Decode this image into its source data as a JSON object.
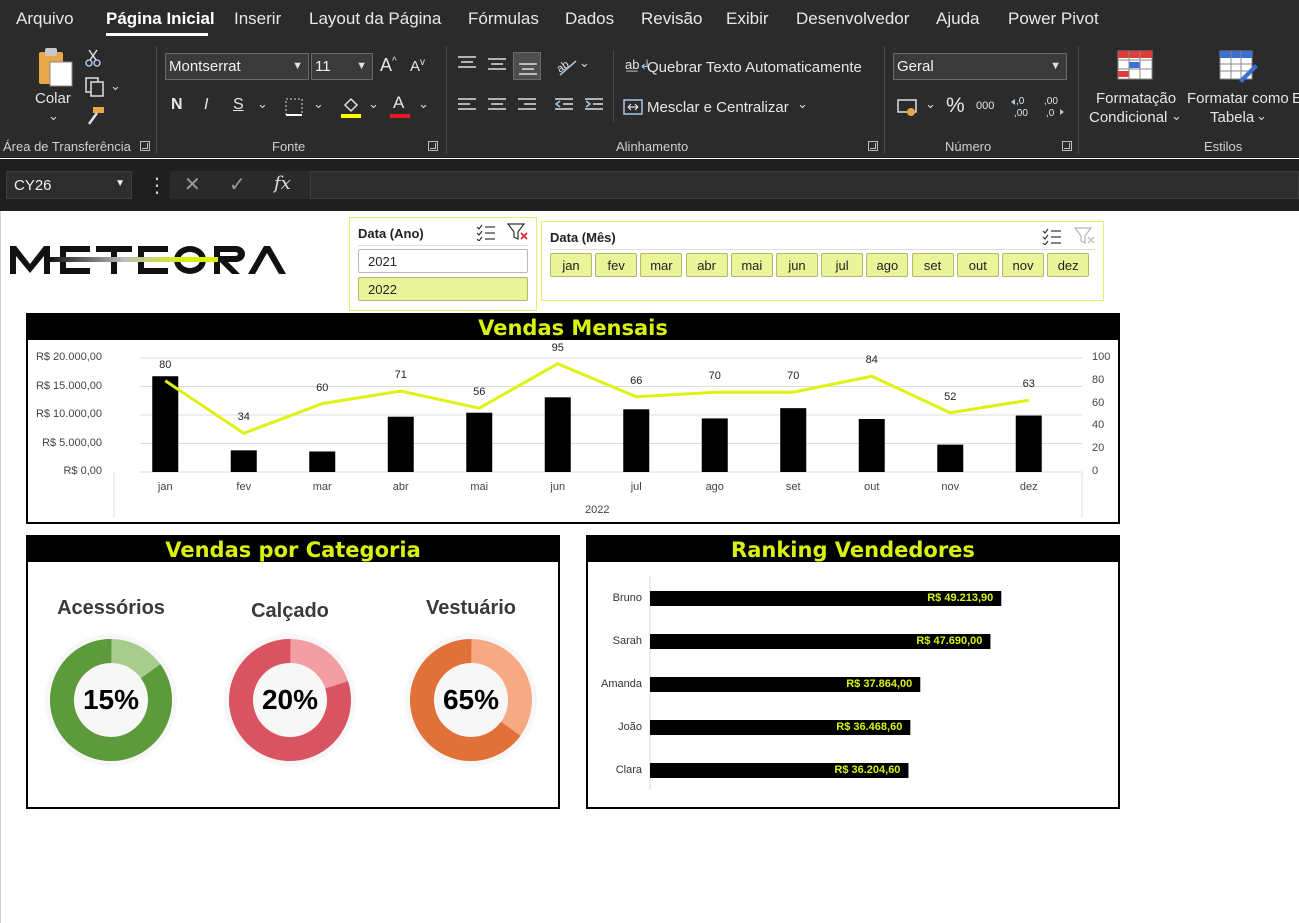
{
  "menu": {
    "tabs": [
      "Arquivo",
      "Página Inicial",
      "Inserir",
      "Layout da Página",
      "Fórmulas",
      "Dados",
      "Revisão",
      "Exibir",
      "Desenvolvedor",
      "Ajuda",
      "Power Pivot"
    ],
    "active": "Página Inicial"
  },
  "ribbon": {
    "clipboard": {
      "paste_label": "Colar",
      "group_label": "Área de Transferência"
    },
    "font": {
      "font_name": "Montserrat",
      "font_size": "11",
      "bold": "N",
      "italic": "I",
      "underline": "S",
      "font_color_glyph": "A",
      "group_label": "Fonte"
    },
    "alignment": {
      "wrap_text": "Quebrar Texto Automaticamente",
      "merge_center": "Mesclar e Centralizar",
      "group_label": "Alinhamento"
    },
    "number": {
      "format": "Geral",
      "percent": "%",
      "thousands": "000",
      "group_label": "Número"
    },
    "styles": {
      "conditional_line1": "Formatação",
      "conditional_line2": "Condicional",
      "table_line1": "Formatar como",
      "table_line2": "Tabela",
      "group_label": "Estilos",
      "truncated": "E"
    }
  },
  "formula_bar": {
    "name_box": "CY26",
    "fx": "fx"
  },
  "slicers": {
    "year": {
      "title": "Data (Ano)",
      "items": [
        "2021",
        "2022"
      ],
      "selected": "2022"
    },
    "month": {
      "title": "Data (Mês)",
      "items": [
        "jan",
        "fev",
        "mar",
        "abr",
        "mai",
        "jun",
        "jul",
        "ago",
        "set",
        "out",
        "nov",
        "dez"
      ]
    }
  },
  "colors": {
    "accent": "#d9f10f",
    "panel_head": "#000000",
    "bar": "#000000",
    "line": "#dff20f"
  },
  "chart_data": [
    {
      "type": "bar",
      "title": "Vendas Mensais",
      "categories": [
        "jan",
        "fev",
        "mar",
        "abr",
        "mai",
        "jun",
        "jul",
        "ago",
        "set",
        "out",
        "nov",
        "dez"
      ],
      "x_group_label": "2022",
      "series": [
        {
          "values": [
            16800,
            3800,
            3600,
            9700,
            10400,
            13100,
            11000,
            9400,
            11200,
            9300,
            4800,
            9900
          ]
        },
        {
          "type": "line",
          "values": [
            80,
            34,
            60,
            71,
            56,
            95,
            66,
            70,
            70,
            84,
            52,
            63
          ]
        }
      ],
      "y_ticks": [
        "R$ 0,00",
        "R$ 5.000,00",
        "R$ 10.000,00",
        "R$ 15.000,00",
        "R$ 20.000,00"
      ],
      "ylim": [
        0,
        20000
      ],
      "y2_ticks": [
        "0",
        "20",
        "40",
        "60",
        "80",
        "100"
      ],
      "y2lim": [
        0,
        100
      ],
      "grid": true
    },
    {
      "type": "pie",
      "title": "Vendas por Categoria",
      "donuts": [
        {
          "category": "Acessórios",
          "percent_label": "15%",
          "value": 15,
          "color": "#5d9a3b",
          "rest_color": "#a8cc8e"
        },
        {
          "category": "Calçado",
          "percent_label": "20%",
          "value": 20,
          "color": "#d95463",
          "rest_color": "#f29ea4"
        },
        {
          "category": "Vestuário",
          "percent_label": "65%",
          "value": 65,
          "color": "#e07239",
          "rest_color": "#f5aa84"
        }
      ]
    },
    {
      "type": "bar",
      "title": "Ranking Vendedores",
      "orientation": "horizontal",
      "categories": [
        "Bruno",
        "Sarah",
        "Amanda",
        "João",
        "Clara"
      ],
      "values": [
        49213.9,
        47690.0,
        37864.0,
        36468.6,
        36204.6
      ],
      "value_labels": [
        "R$ 49.213,90",
        "R$ 47.690,00",
        "R$ 37.864,00",
        "R$ 36.468,60",
        "R$ 36.204,60"
      ],
      "xlim": [
        0,
        65000
      ]
    }
  ]
}
